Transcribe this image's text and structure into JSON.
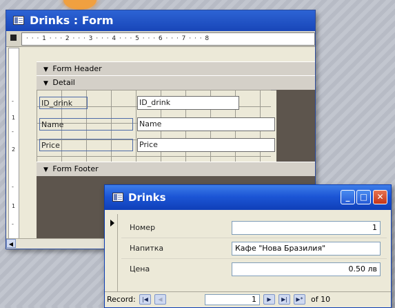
{
  "design_window": {
    "title": "Drinks : Form",
    "ruler_marks": "· · · 1 · · · 2 · · · 3 · · · 4 · · · 5 · · · 6 · · · 7 · · · 8",
    "vertical_ruler": [
      "-",
      "1",
      "-",
      "2",
      "-",
      "1",
      "-"
    ],
    "sections": {
      "form_header": "Form Header",
      "detail": "Detail",
      "form_footer": "Form Footer"
    },
    "fields": [
      {
        "label": "ID_drink",
        "control": "ID_drink"
      },
      {
        "label": "Name",
        "control": "Name"
      },
      {
        "label": "Price",
        "control": "Price"
      }
    ]
  },
  "drinks_window": {
    "title": "Drinks",
    "controls": {
      "minimize": "_",
      "maximize": "□",
      "close": "✕"
    },
    "fields": [
      {
        "label": "Номер",
        "value": "1"
      },
      {
        "label": "Напитка",
        "value": "Кафе \"Нова Бразилия\""
      },
      {
        "label": "Цена",
        "value": "0.50 лв"
      }
    ],
    "navigation": {
      "record_label": "Record:",
      "current": "1",
      "of_text": "of 10",
      "first_glyph": "|◀",
      "prev_glyph": "◀",
      "next_glyph": "▶",
      "last_glyph": "▶|",
      "new_glyph": "▶*"
    }
  },
  "colors": {
    "title_bar_blue": "#1c56d6",
    "close_button_red": "#c5361a",
    "detail_dark": "#5d554d"
  }
}
